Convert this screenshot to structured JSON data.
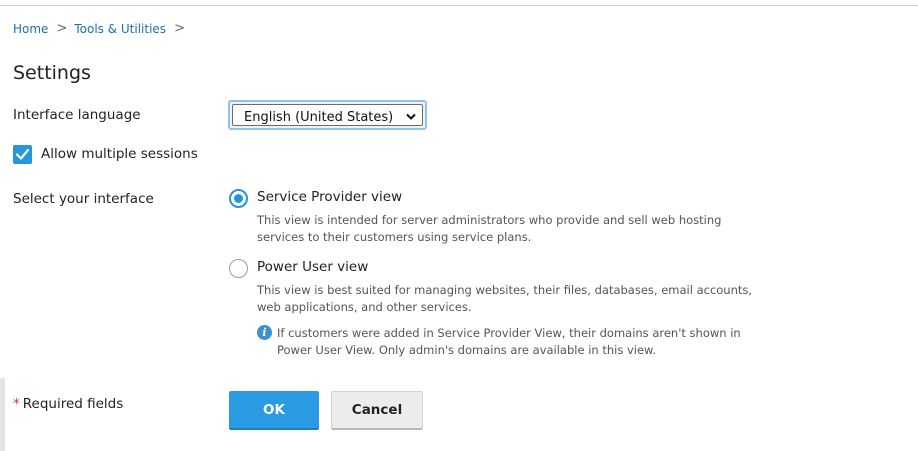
{
  "breadcrumb": {
    "items": [
      "Home",
      "Tools & Utilities"
    ],
    "separator": ">"
  },
  "page_title": "Settings",
  "language": {
    "label": "Interface language",
    "selected": "English (United States)"
  },
  "sessions": {
    "label": "Allow multiple sessions",
    "checked": true
  },
  "interface": {
    "label": "Select your interface",
    "options": [
      {
        "label": "Service Provider view",
        "description": "This view is intended for server administrators who provide and sell web hosting services to their customers using service plans.",
        "selected": true
      },
      {
        "label": "Power User view",
        "description": "This view is best suited for managing websites, their files, databases, email accounts, web applications, and other services.",
        "selected": false
      }
    ],
    "info_note": "If customers were added in Service Provider View, their domains aren't shown in Power User View. Only admin's domains are available in this view."
  },
  "required_fields": {
    "marker": "*",
    "label": "Required fields"
  },
  "buttons": {
    "ok": "OK",
    "cancel": "Cancel"
  },
  "colors": {
    "accent": "#2497d8",
    "link": "#1f6fab",
    "ok_button": "#2a9be3"
  }
}
